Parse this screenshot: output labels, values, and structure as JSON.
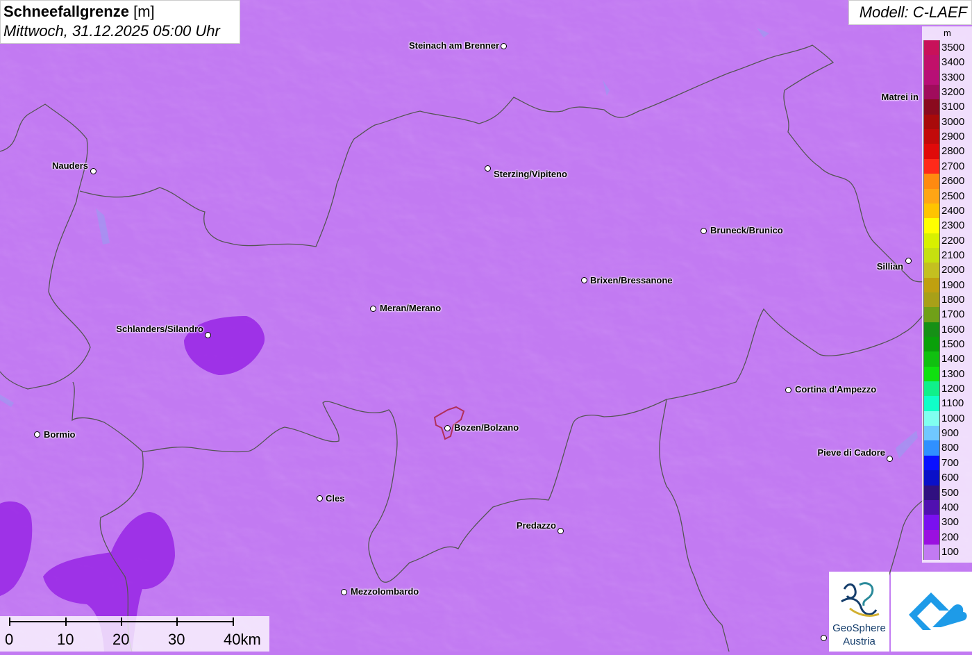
{
  "header": {
    "title_bold": "Schneefallgrenze",
    "title_unit": "[m]",
    "subtitle": "Mittwoch, 31.12.2025 05:00 Uhr",
    "model": "Modell: C-LAEF"
  },
  "legend": {
    "unit": "m",
    "levels": [
      {
        "label": "3500",
        "color": "#c8115a"
      },
      {
        "label": "3400",
        "color": "#c1106a"
      },
      {
        "label": "3300",
        "color": "#b80f76"
      },
      {
        "label": "3200",
        "color": "#a00c5c"
      },
      {
        "label": "3100",
        "color": "#8a0a1e"
      },
      {
        "label": "3000",
        "color": "#a80a0a"
      },
      {
        "label": "2900",
        "color": "#c20a0a"
      },
      {
        "label": "2800",
        "color": "#e00a0a"
      },
      {
        "label": "2700",
        "color": "#ff2a1a"
      },
      {
        "label": "2600",
        "color": "#ff8a10"
      },
      {
        "label": "2500",
        "color": "#ffa515"
      },
      {
        "label": "2400",
        "color": "#ffc400"
      },
      {
        "label": "2300",
        "color": "#ffff00"
      },
      {
        "label": "2200",
        "color": "#d8f000"
      },
      {
        "label": "2100",
        "color": "#c6e010"
      },
      {
        "label": "2000",
        "color": "#c4c020"
      },
      {
        "label": "1900",
        "color": "#c0a010"
      },
      {
        "label": "1800",
        "color": "#a8a018"
      },
      {
        "label": "1700",
        "color": "#70a018"
      },
      {
        "label": "1600",
        "color": "#169016"
      },
      {
        "label": "1500",
        "color": "#0aa00a"
      },
      {
        "label": "1400",
        "color": "#10c010"
      },
      {
        "label": "1300",
        "color": "#10e010"
      },
      {
        "label": "1200",
        "color": "#10f08a"
      },
      {
        "label": "1100",
        "color": "#10ffc8"
      },
      {
        "label": "1000",
        "color": "#80fff0"
      },
      {
        "label": "900",
        "color": "#70c8ff"
      },
      {
        "label": "800",
        "color": "#3090ff"
      },
      {
        "label": "700",
        "color": "#0a10ff"
      },
      {
        "label": "600",
        "color": "#0a10c8"
      },
      {
        "label": "500",
        "color": "#301080"
      },
      {
        "label": "400",
        "color": "#5010b0"
      },
      {
        "label": "300",
        "color": "#7a10f0"
      },
      {
        "label": "200",
        "color": "#9a10e0"
      },
      {
        "label": "100",
        "color": "#c27af2"
      }
    ]
  },
  "cities": [
    {
      "name": "Steinach am Brenner",
      "side": "left"
    },
    {
      "name": "Nauders",
      "side": "left"
    },
    {
      "name": "Sterzing/Vipiteno",
      "side": "right"
    },
    {
      "name": "Matrei in",
      "side": "left"
    },
    {
      "name": "Bruneck/Brunico",
      "side": "right"
    },
    {
      "name": "Sillian",
      "side": "left"
    },
    {
      "name": "Brixen/Bressanone",
      "side": "right"
    },
    {
      "name": "Meran/Merano",
      "side": "right"
    },
    {
      "name": "Schlanders/Silandro",
      "side": "left"
    },
    {
      "name": "Cortina d'Ampezzo",
      "side": "right"
    },
    {
      "name": "Bormio",
      "side": "right"
    },
    {
      "name": "Bozen/Bolzano",
      "side": "right"
    },
    {
      "name": "Pieve di Cadore",
      "side": "left"
    },
    {
      "name": "Cles",
      "side": "right"
    },
    {
      "name": "Predazzo",
      "side": "left"
    },
    {
      "name": "Mezzolombardo",
      "side": "right"
    }
  ],
  "scale_bar": {
    "labels": [
      "0",
      "10",
      "20",
      "30",
      "40km"
    ]
  },
  "logos": {
    "geosphere_line1": "GeoSphere",
    "geosphere_line2": "Austria"
  },
  "colors": {
    "base": "#c27af2",
    "band_200": "#9a2ae6",
    "band_300": "#8e1fe0",
    "border": "#555555",
    "bolzano_outline": "#b0305a"
  }
}
